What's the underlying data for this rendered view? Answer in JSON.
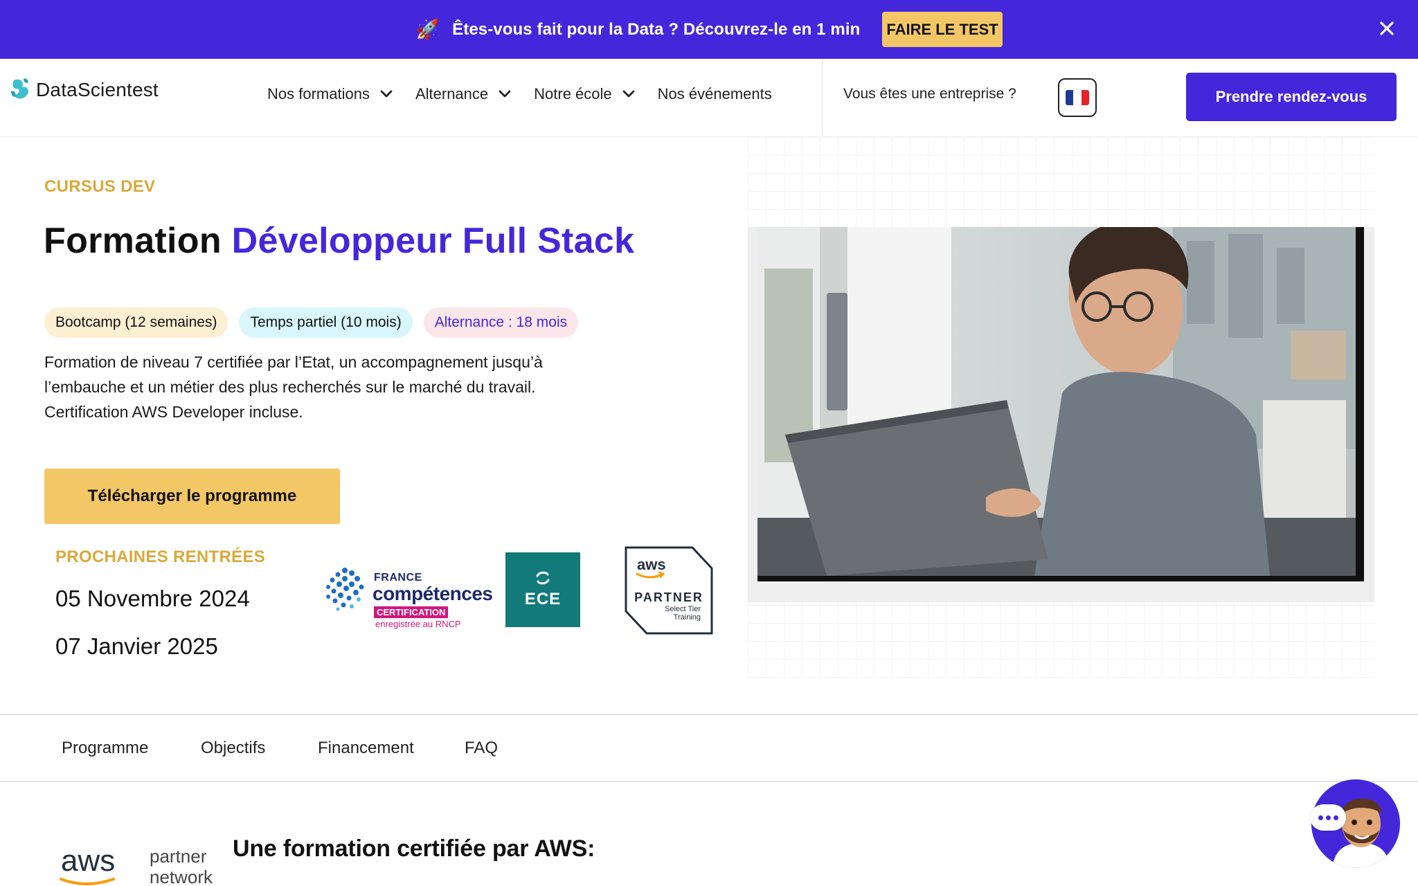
{
  "promo": {
    "text": "Êtes-vous fait pour la Data ? Découvrez-le en 1 min",
    "cta": "FAIRE LE TEST",
    "close_icon": "close-icon",
    "rocket_icon": "rocket-icon"
  },
  "nav": {
    "brand": "DataScientest",
    "menu": [
      {
        "label": "Nos formations",
        "icon": "chevron-down-icon"
      },
      {
        "label": "Alternance",
        "icon": "chevron-down-icon"
      },
      {
        "label": "Notre école",
        "icon": "chevron-down-icon"
      },
      {
        "label": "Nos événements"
      }
    ],
    "enterprise": "Vous êtes une entreprise ?",
    "language_icon": "french-flag-icon",
    "cta": "Prendre rendez-vous"
  },
  "hero": {
    "eyebrow": "CURSUS DEV",
    "title_prefix": "Formation",
    "title_accent": "Développeur Full Stack",
    "tags": [
      "Bootcamp (12 semaines)",
      "Temps partiel (10 mois)",
      "Alternance : 18 mois"
    ],
    "description": "Formation de niveau 7 certifiée par l’Etat, un accompagnement jusqu’à l’embauche et un métier des plus recherchés sur le marché du travail. Certification AWS Developer incluse.",
    "download_cta": "Télécharger le programme",
    "rentrees_label": "PROCHAINES RENTRÉES",
    "dates": [
      "05 Novembre 2024",
      "07 Janvier 2025"
    ]
  },
  "logos": {
    "france_competences": {
      "line1": "FRANCE",
      "line2": "compétences",
      "badge": "CERTIFICATION",
      "line3": "enregistrée au RNCP"
    },
    "ece": {
      "text": "ECE"
    },
    "aws_badge": {
      "top": "aws",
      "middle": "PARTNER",
      "bottom1": "Select Tier",
      "bottom2": "Training"
    }
  },
  "section_tabs": [
    "Programme",
    "Objectifs",
    "Financement",
    "FAQ"
  ],
  "aws_section": {
    "logo_aws": "aws",
    "logo_partner": "partner",
    "logo_network": "network",
    "heading": "Une formation certifiée par AWS:"
  },
  "colors": {
    "primary": "#4427db",
    "accent_yellow": "#f3c766",
    "eyebrow_gold": "#d9a93a"
  }
}
